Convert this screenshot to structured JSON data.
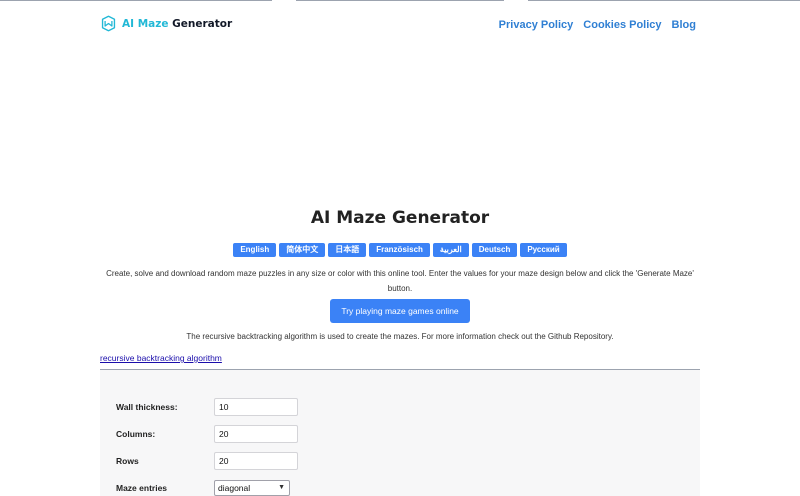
{
  "header": {
    "logo_accent": "AI Maze",
    "logo_rest": " Generator",
    "nav": [
      "Privacy Policy",
      "Cookies Policy",
      "Blog"
    ]
  },
  "main": {
    "title": "AI Maze Generator",
    "languages": [
      "English",
      "简体中文",
      "日本語",
      "Französisch",
      "العربية",
      "Deutsch",
      "Русский"
    ],
    "description": "Create, solve and download random maze puzzles in any size or color with this online tool. Enter the values for your maze design below and click the 'Generate Maze' button.",
    "play_button": "Try playing maze games online",
    "algo_note": "The recursive backtracking algorithm is used to create the mazes. For more information check out the Github Repository.",
    "algo_link": "recursive backtracking algorithm"
  },
  "form": {
    "wall_thickness": {
      "label": "Wall thickness:",
      "value": "10"
    },
    "columns": {
      "label": "Columns:",
      "value": "20"
    },
    "rows": {
      "label": "Rows",
      "value": "20"
    },
    "entries": {
      "label": "Maze entries",
      "value": "diagonal"
    }
  },
  "colors": {
    "accent": "#3b82f6",
    "logo_accent": "#22b8d6",
    "nav_link": "#2f7fd3"
  }
}
